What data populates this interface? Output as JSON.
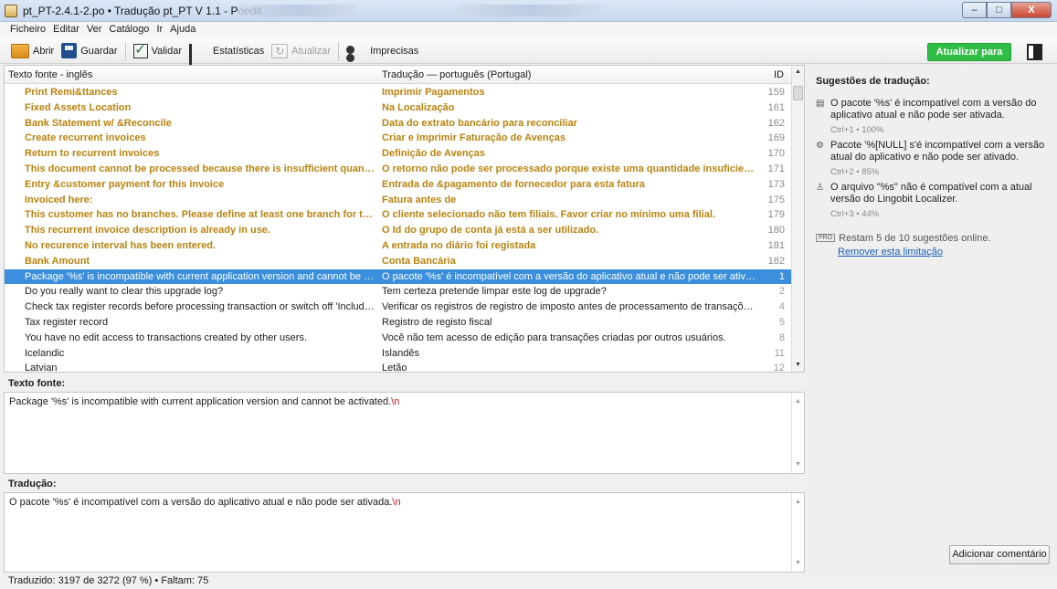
{
  "window": {
    "title": "pt_PT-2.4.1-2.po • Tradução pt_PT V 1.1 - Poedit",
    "minimize": "–",
    "maximize": "□",
    "close": "X"
  },
  "menu": [
    "Ficheiro",
    "Editar",
    "Ver",
    "Catálogo",
    "Ir",
    "Ajuda"
  ],
  "toolbar": {
    "open": "Abrir",
    "save": "Guardar",
    "validate": "Validar",
    "stats": "Estatísticas",
    "update": "Atualizar",
    "fuzzy": "Imprecisas",
    "pro_button": "Atualizar para Pro"
  },
  "list": {
    "col_source": "Texto fonte - inglês",
    "col_translation": "Tradução — português (Portugal)",
    "col_id": "ID",
    "rows": [
      {
        "src": "Print Remi&ttances",
        "trn": "Imprimir Pagamentos",
        "id": "159",
        "fuzzy": true
      },
      {
        "src": "Fixed Assets Location",
        "trn": "Na Localização",
        "id": "161",
        "fuzzy": true
      },
      {
        "src": "Bank Statement w/ &Reconcile",
        "trn": "Data do extrato bancário para reconciliar",
        "id": "162",
        "fuzzy": true
      },
      {
        "src": "Create recurrent invoices",
        "trn": "Criar e Imprimir Faturação de Avenças",
        "id": "169",
        "fuzzy": true
      },
      {
        "src": "Return to recurrent invoices",
        "trn": "Definição de Avenças",
        "id": "170",
        "fuzzy": true
      },
      {
        "src": "This document cannot be processed because there is insufficient quantity for ite...",
        "trn": "O retorno não pode ser processado porque existe uma quantidade insuficiente de ...",
        "id": "171",
        "fuzzy": true
      },
      {
        "src": "Entry &customer payment for this invoice",
        "trn": "Entrada de &pagamento de fornecedor para esta fatura",
        "id": "173",
        "fuzzy": true
      },
      {
        "src": "Invoiced here:",
        "trn": "Fatura antes de",
        "id": "175",
        "fuzzy": true
      },
      {
        "src": "This customer has no branches. Please define at least one branch for this custom...",
        "trn": "O cliente selecionado não tem filiais. Favor criar no mínimo uma filial.",
        "id": "179",
        "fuzzy": true
      },
      {
        "src": "This recurrent invoice description is already in use.",
        "trn": "O Id do grupo de conta já está a ser utilizado.",
        "id": "180",
        "fuzzy": true
      },
      {
        "src": "No recurence interval has been entered.",
        "trn": "A entrada no diário foi registada",
        "id": "181",
        "fuzzy": true
      },
      {
        "src": "Bank Amount",
        "trn": "Conta Bancária",
        "id": "182",
        "fuzzy": true
      },
      {
        "src": "Package '%s' is incompatible with current application version and cannot be activated.",
        "trn": "O pacote '%s' é incompatível com a versão do aplicativo atual e não pode ser ativada.",
        "id": "1",
        "selected": true
      },
      {
        "src": "Do you really want to clear this upgrade log?",
        "trn": "Tem certeza pretende limpar este log de upgrade?",
        "id": "2"
      },
      {
        "src": "Check tax register records before processing transaction or switch off 'Include in tax r...",
        "trn": "Verificar os registros de registro de imposto antes de processamento de transações ou ...",
        "id": "4"
      },
      {
        "src": "Tax register record",
        "trn": "Registro de registo fiscal",
        "id": "5"
      },
      {
        "src": "You have no edit access to transactions created by other users.",
        "trn": "Você não tem acesso de edição para transações criadas por outros usuários.",
        "id": "8"
      },
      {
        "src": "Icelandic",
        "trn": "Islandês",
        "id": "11"
      },
      {
        "src": "Latvian",
        "trn": "Letão",
        "id": "12"
      }
    ]
  },
  "source": {
    "label": "Texto fonte:",
    "text": "Package '%s' is incompatible with current application version and cannot be activated.",
    "newline": "\\n"
  },
  "translation": {
    "label": "Tradução:",
    "text": "O pacote '%s' é incompatível com a versão do aplicativo atual e não pode ser ativada.",
    "newline": "\\n"
  },
  "sidebar": {
    "title": "Sugestões de tradução:",
    "suggestions": [
      {
        "text": "O pacote '%s' é incompatível com a versão do aplicativo atual e não pode ser ativada.",
        "meta": "Ctrl+1 • 100%",
        "icon": "database-icon"
      },
      {
        "text": "Pacote '%[NULL] s'é incompatível com a versão atual do aplicativo e não pode ser ativado.",
        "meta": "Ctrl+2 • 85%",
        "icon": "gear-icon"
      },
      {
        "text": "O arquivo \"%s\" não é compatível com a atual versão do Lingobit Localizer.",
        "meta": "Ctrl+3 • 44%",
        "icon": "user-icon"
      }
    ],
    "pro_badge": "PRO",
    "pro_text": "Restam 5 de 10 sugestões online.",
    "pro_link": "Remover esta limitação",
    "add_comment": "Adicionar comentário"
  },
  "status": "Traduzido: 3197 de 3272 (97 %)  •  Faltam: 75",
  "colors": {
    "fuzzy": "#b98310",
    "selected": "#3b8fdc",
    "pro": "#2fbd45",
    "link": "#1a5fb4"
  }
}
